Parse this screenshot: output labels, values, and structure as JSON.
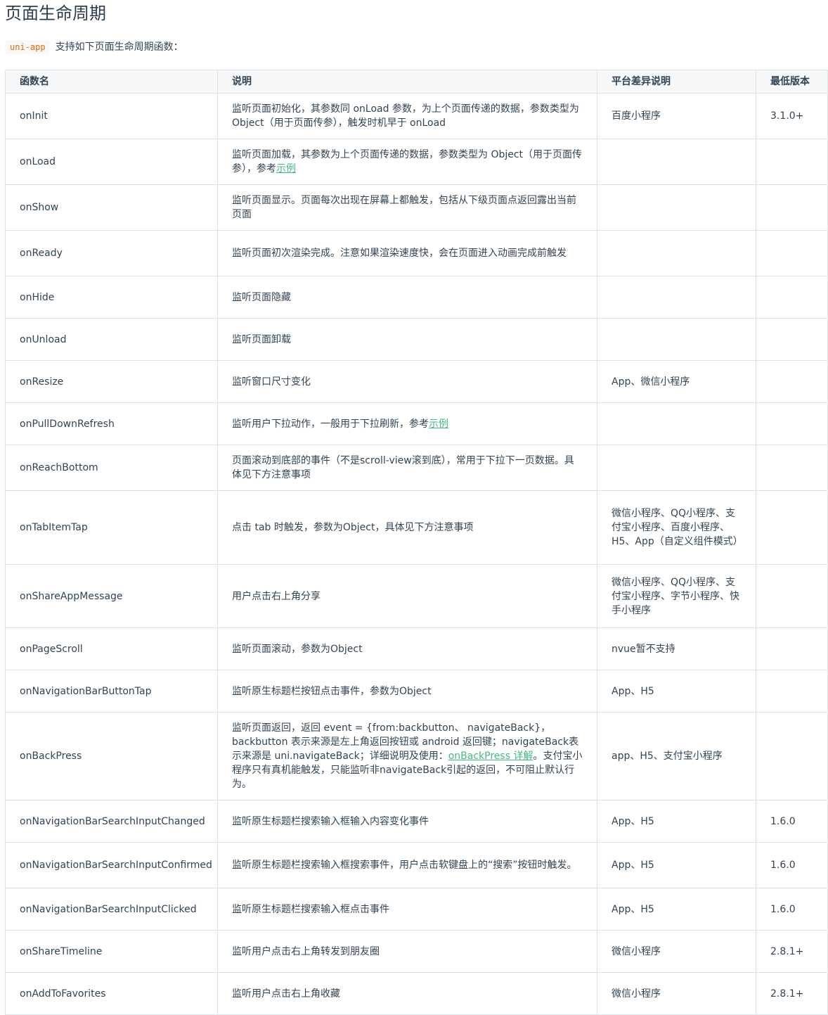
{
  "title": "页面生命周期",
  "intro": {
    "code": "uni-app",
    "text": "支持如下页面生命周期函数："
  },
  "table": {
    "headers": [
      "函数名",
      "说明",
      "平台差异说明",
      "最低版本"
    ],
    "rows": [
      {
        "name": "onInit",
        "desc": "监听页面初始化，其参数同 onLoad 参数，为上个页面传递的数据，参数类型为 Object（用于页面传参），触发时机早于 onLoad",
        "platform": "百度小程序",
        "version": "3.1.0+"
      },
      {
        "name": "onLoad",
        "desc": "监听页面加载，其参数为上个页面传递的数据，参数类型为 Object（用于页面传参），参考",
        "link": "示例",
        "desc_after": "",
        "platform": "",
        "version": ""
      },
      {
        "name": "onShow",
        "desc": "监听页面显示。页面每次出现在屏幕上都触发，包括从下级页面点返回露出当前页面",
        "platform": "",
        "version": ""
      },
      {
        "name": "onReady",
        "desc": "监听页面初次渲染完成。注意如果渲染速度快，会在页面进入动画完成前触发",
        "platform": "",
        "version": ""
      },
      {
        "name": "onHide",
        "desc": "监听页面隐藏",
        "platform": "",
        "version": ""
      },
      {
        "name": "onUnload",
        "desc": "监听页面卸载",
        "platform": "",
        "version": ""
      },
      {
        "name": "onResize",
        "desc": "监听窗口尺寸变化",
        "platform": "App、微信小程序",
        "version": ""
      },
      {
        "name": "onPullDownRefresh",
        "desc": "监听用户下拉动作，一般用于下拉刷新，参考",
        "link": "示例",
        "desc_after": "",
        "platform": "",
        "version": ""
      },
      {
        "name": "onReachBottom",
        "desc": "页面滚动到底部的事件（不是scroll-view滚到底），常用于下拉下一页数据。具体见下方注意事项",
        "platform": "",
        "version": ""
      },
      {
        "name": "onTabItemTap",
        "desc": "点击 tab 时触发，参数为Object，具体见下方注意事项",
        "platform": "微信小程序、QQ小程序、支付宝小程序、百度小程序、H5、App（自定义组件模式）",
        "version": ""
      },
      {
        "name": "onShareAppMessage",
        "desc": "用户点击右上角分享",
        "platform": "微信小程序、QQ小程序、支付宝小程序、字节小程序、快手小程序",
        "version": ""
      },
      {
        "name": "onPageScroll",
        "desc": "监听页面滚动，参数为Object",
        "platform": "nvue暂不支持",
        "version": ""
      },
      {
        "name": "onNavigationBarButtonTap",
        "desc": "监听原生标题栏按钮点击事件，参数为Object",
        "platform": "App、H5",
        "version": ""
      },
      {
        "name": "onBackPress",
        "desc": "监听页面返回，返回 event = {from:backbutton、 navigateBack}，backbutton 表示来源是左上角返回按钮或 android 返回键；navigateBack表示来源是 uni.navigateBack；详细说明及使用：",
        "link": "onBackPress 详解",
        "desc_after": "。支付宝小程序只有真机能触发，只能监听非navigateBack引起的返回，不可阻止默认行为。",
        "platform": "app、H5、支付宝小程序",
        "version": ""
      },
      {
        "name": "onNavigationBarSearchInputChanged",
        "desc": "监听原生标题栏搜索输入框输入内容变化事件",
        "platform": "App、H5",
        "version": "1.6.0"
      },
      {
        "name": "onNavigationBarSearchInputConfirmed",
        "desc": "监听原生标题栏搜索输入框搜索事件，用户点击软键盘上的“搜索”按钮时触发。",
        "platform": "App、H5",
        "version": "1.6.0"
      },
      {
        "name": "onNavigationBarSearchInputClicked",
        "desc": "监听原生标题栏搜索输入框点击事件",
        "platform": "App、H5",
        "version": "1.6.0"
      },
      {
        "name": "onShareTimeline",
        "desc": "监听用户点击右上角转发到朋友圈",
        "platform": "微信小程序",
        "version": "2.8.1+"
      },
      {
        "name": "onAddToFavorites",
        "desc": "监听用户点击右上角收藏",
        "platform": "微信小程序",
        "version": "2.8.1+"
      }
    ]
  }
}
